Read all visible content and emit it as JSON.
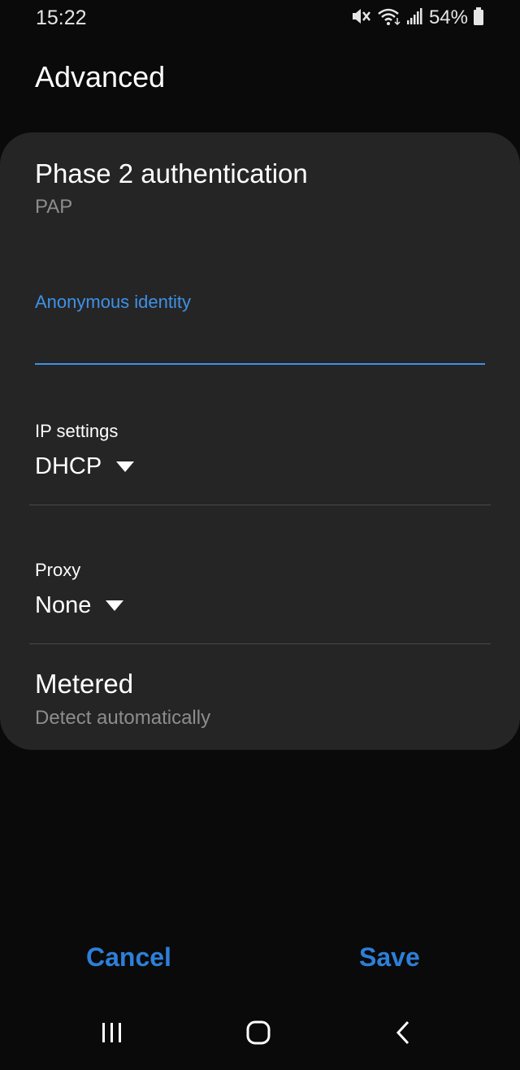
{
  "status_bar": {
    "time": "15:22",
    "battery": "54%",
    "icons": [
      "mute-icon",
      "wifi-icon",
      "signal-icon",
      "battery-icon"
    ]
  },
  "page": {
    "title": "Advanced"
  },
  "settings": {
    "phase2": {
      "title": "Phase 2 authentication",
      "value": "PAP"
    },
    "anonymous_identity": {
      "label": "Anonymous identity",
      "value": ""
    },
    "ip_settings": {
      "label": "IP settings",
      "value": "DHCP"
    },
    "proxy": {
      "label": "Proxy",
      "value": "None"
    },
    "metered": {
      "title": "Metered",
      "value": "Detect automatically"
    }
  },
  "actions": {
    "cancel_label": "Cancel",
    "save_label": "Save"
  },
  "nav_bar": {
    "icons": [
      "recents-icon",
      "home-icon",
      "back-icon"
    ]
  },
  "colors": {
    "accent": "#3e91e8",
    "button": "#2d7fd9",
    "card": "#252525",
    "background": "#0a0a0a"
  }
}
